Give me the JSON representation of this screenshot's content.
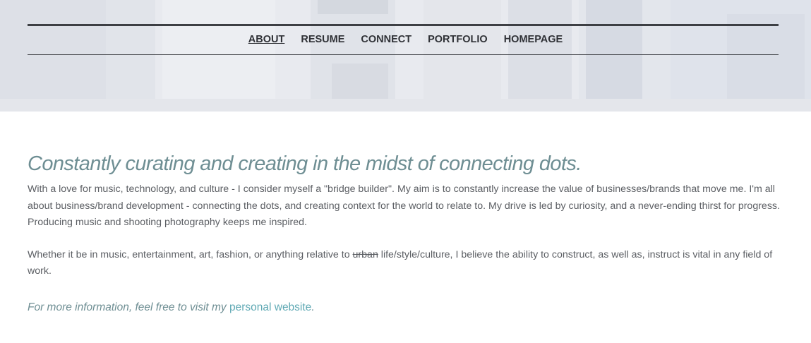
{
  "nav": {
    "items": [
      {
        "label": "ABOUT",
        "active": true
      },
      {
        "label": "RESUME",
        "active": false
      },
      {
        "label": "CONNECT",
        "active": false
      },
      {
        "label": "PORTFOLIO",
        "active": false
      },
      {
        "label": "HOMEPAGE",
        "active": false
      }
    ]
  },
  "main": {
    "headline": "Constantly curating and creating in the midst of connecting dots.",
    "paragraph1": "With a love for music, technology, and culture - I consider myself a \"bridge builder\". My aim is to constantly increase the value of businesses/brands that move me. I'm all about business/brand development - connecting the dots, and creating context for the world to relate to. My drive is led by curiosity, and a never-ending thirst for progress. Producing music and shooting photography keeps me inspired.",
    "paragraph2": {
      "before": "Whether it be in music, entertainment, art, fashion, or anything relative to ",
      "struck": "urban",
      "after": " life/style/culture, I believe the ability to construct, as well as, instruct is vital in any field of work."
    },
    "more_info": {
      "prefix": "For more information, feel free to visit my ",
      "link_label": "personal website",
      "suffix": "."
    }
  },
  "colors": {
    "accent": "#6e8e93",
    "link": "#5fa9b4",
    "body_text": "#5b5e63",
    "nav_text": "#2f3136"
  }
}
